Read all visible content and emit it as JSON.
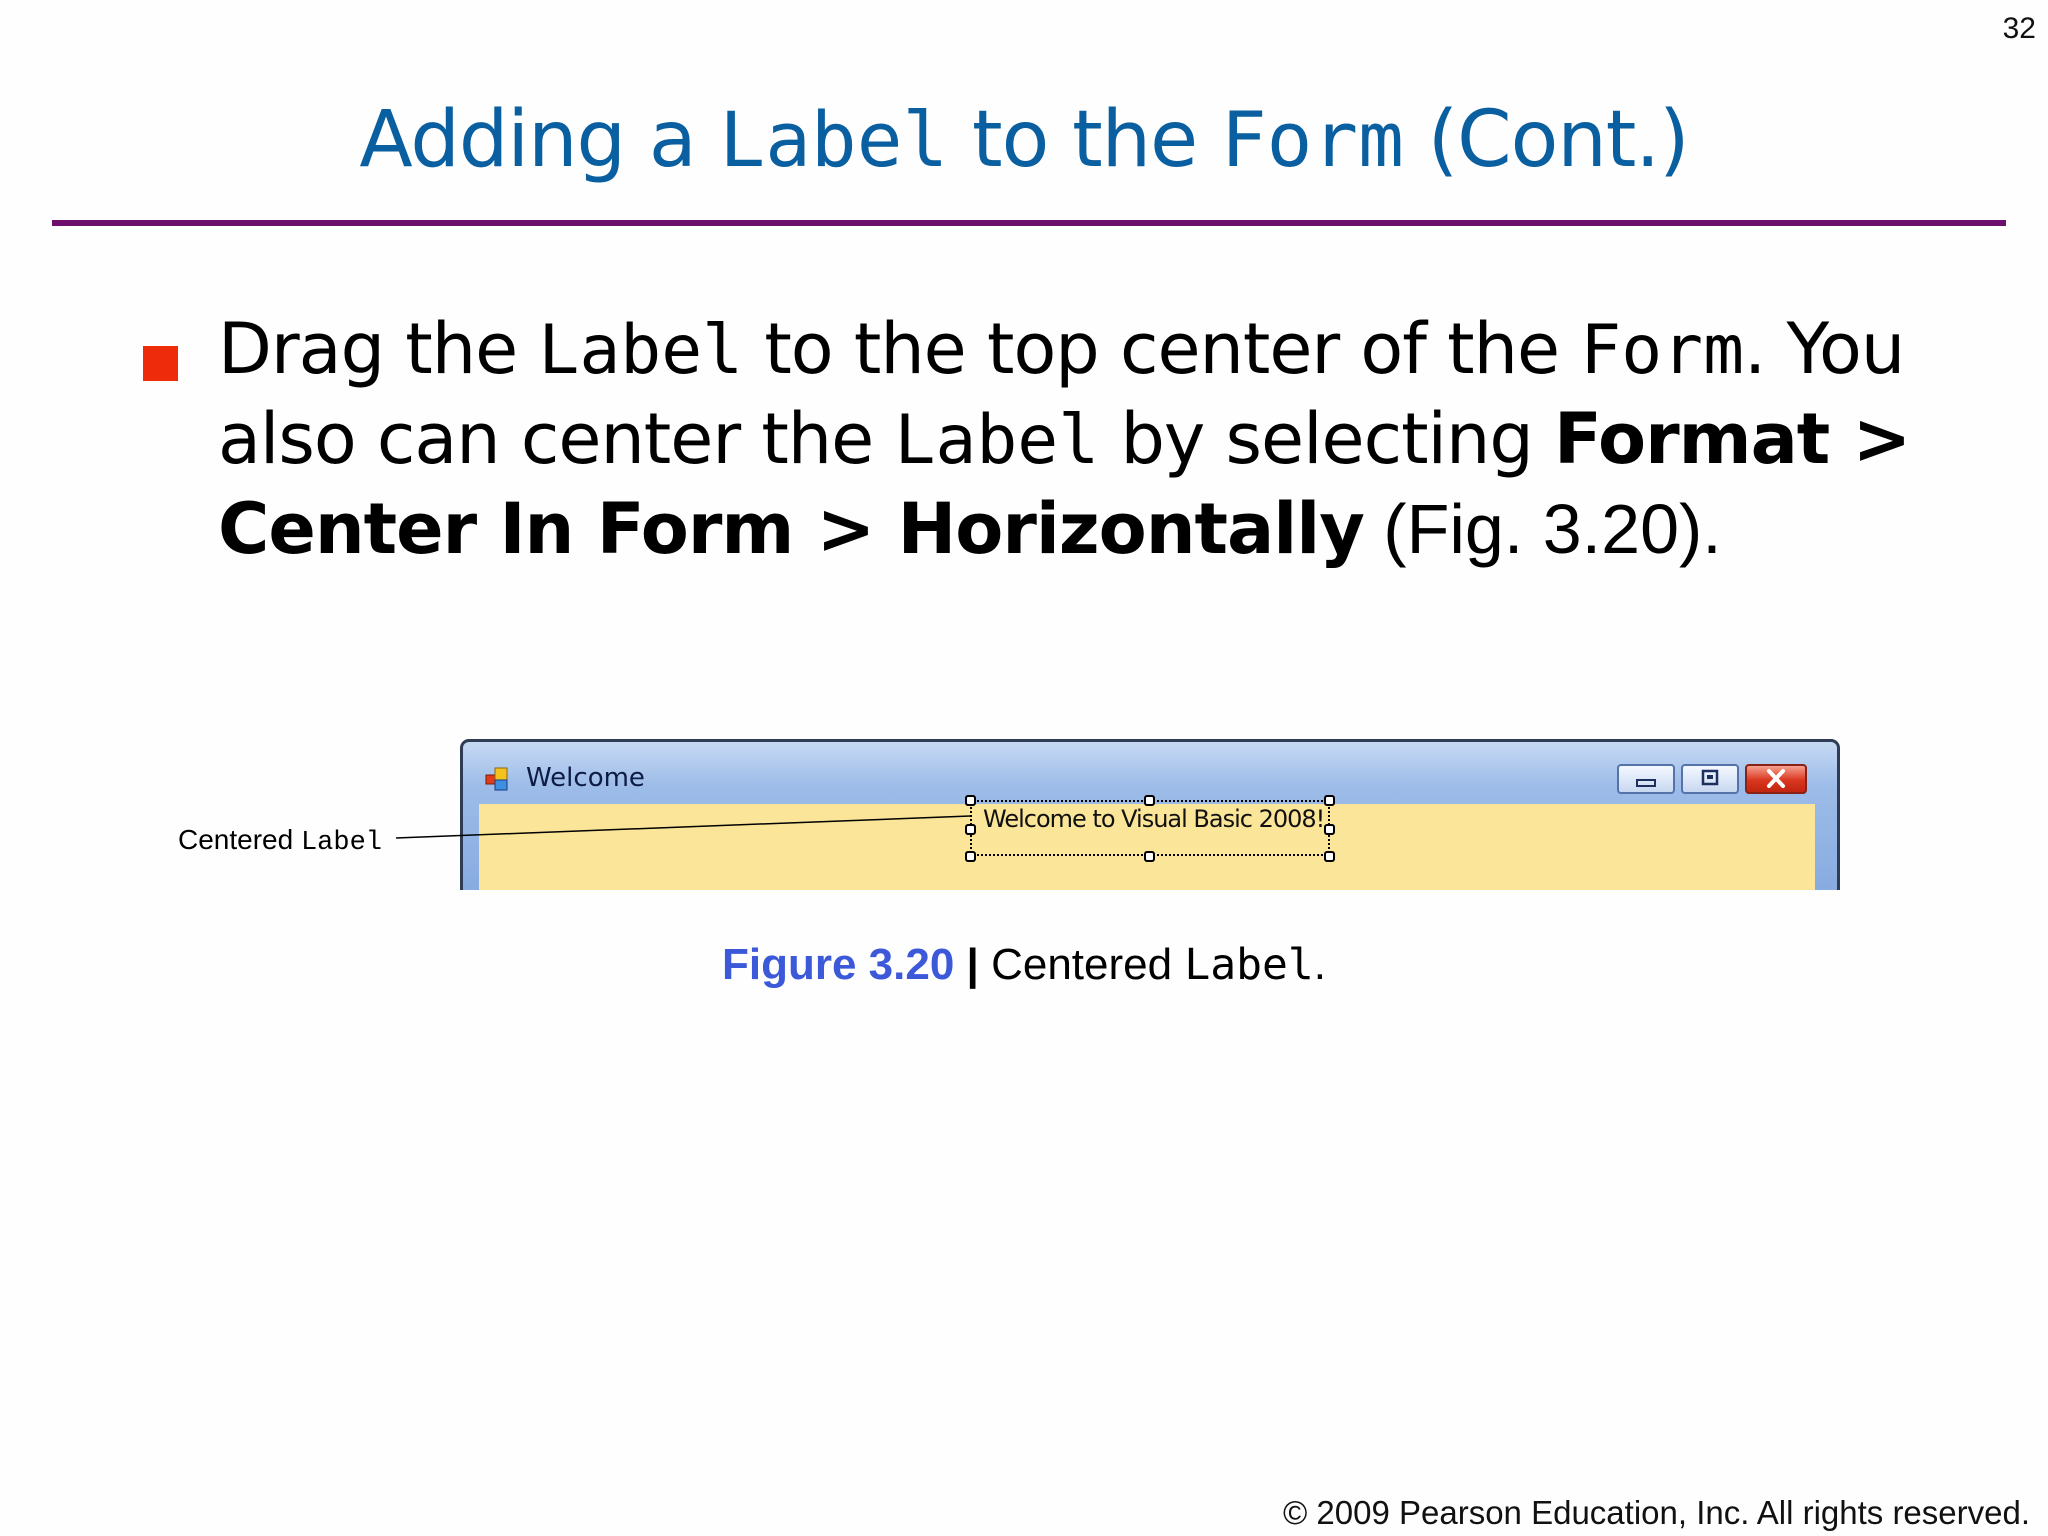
{
  "slide_number": "32",
  "title": {
    "part1": "Adding a ",
    "code1": "Label",
    "part2": " to the ",
    "code2": "Form",
    "part3": " (Cont.)"
  },
  "bullet": {
    "t1": "Drag the ",
    "c1": "Label",
    "t2": " to the top center of the ",
    "c2": "Form",
    "t3": ". You also can center the ",
    "c3": "Label",
    "t4": " by selecting ",
    "b1": "Format > Center In Form > Horizontally",
    "t5": " (Fig. 3.20)."
  },
  "figure": {
    "window_title": "Welcome",
    "label_text": "Welcome to Visual Basic 2008!",
    "callout_text": "Centered ",
    "callout_code": "Label"
  },
  "caption": {
    "figure_number": "Figure 3.20",
    "separator": "|",
    "text": " Centered ",
    "code": "Label",
    "end": "."
  },
  "footer": "© 2009 Pearson Education, Inc.  All rights reserved.",
  "colors": {
    "title": "#0a5fa0",
    "rule": "#6e0f6e",
    "bullet": "#ee2b0a",
    "figure_number": "#3b59d9",
    "form_background": "#fbe598"
  }
}
